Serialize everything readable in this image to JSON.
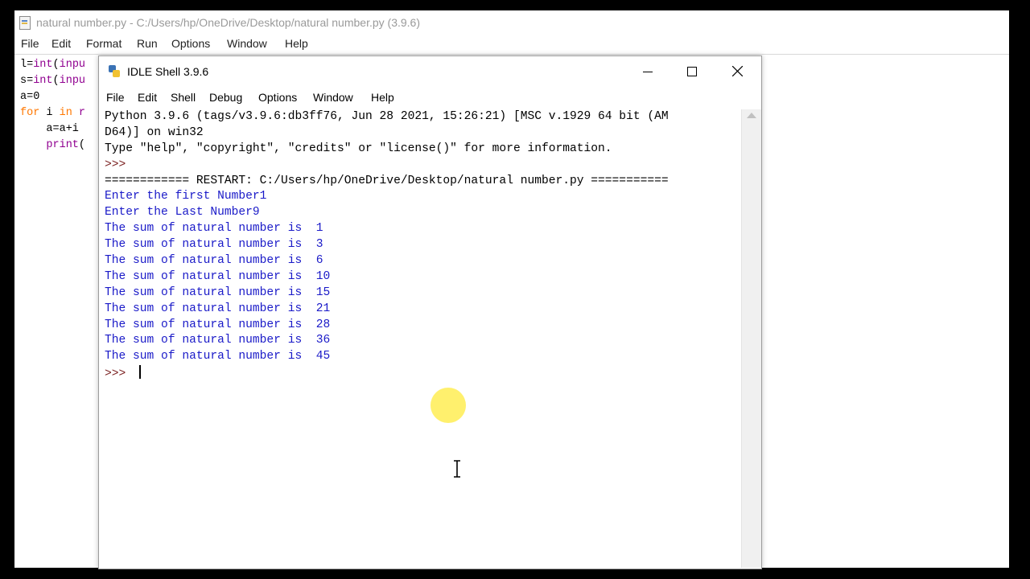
{
  "editor": {
    "title": "natural number.py - C:/Users/hp/OneDrive/Desktop/natural number.py (3.9.6)",
    "menu": [
      "File",
      "Edit",
      "Format",
      "Run",
      "Options",
      "Window",
      "Help"
    ],
    "code_lines": [
      {
        "segments": [
          {
            "t": "l=",
            "c": "tx"
          },
          {
            "t": "int",
            "c": "bi"
          },
          {
            "t": "(",
            "c": "tx"
          },
          {
            "t": "inpu",
            "c": "bi"
          }
        ]
      },
      {
        "segments": [
          {
            "t": "s=",
            "c": "tx"
          },
          {
            "t": "int",
            "c": "bi"
          },
          {
            "t": "(",
            "c": "tx"
          },
          {
            "t": "inpu",
            "c": "bi"
          }
        ]
      },
      {
        "segments": [
          {
            "t": "a=0",
            "c": "tx"
          }
        ]
      },
      {
        "segments": [
          {
            "t": "for",
            "c": "kw"
          },
          {
            "t": " i ",
            "c": "tx"
          },
          {
            "t": "in",
            "c": "kw"
          },
          {
            "t": " r",
            "c": "bi"
          }
        ]
      },
      {
        "segments": [
          {
            "t": "    a=a+i",
            "c": "tx"
          }
        ]
      },
      {
        "segments": [
          {
            "t": "    ",
            "c": "tx"
          },
          {
            "t": "print",
            "c": "bi"
          },
          {
            "t": "(",
            "c": "tx"
          }
        ]
      }
    ]
  },
  "shell": {
    "title": "IDLE Shell 3.9.6",
    "menu": [
      "File",
      "Edit",
      "Shell",
      "Debug",
      "Options",
      "Window",
      "Help"
    ],
    "lines": [
      {
        "text": "Python 3.9.6 (tags/v3.9.6:db3ff76, Jun 28 2021, 15:26:21) [MSC v.1929 64 bit (AM",
        "kind": "console"
      },
      {
        "text": "D64)] on win32",
        "kind": "console"
      },
      {
        "text": "Type \"help\", \"copyright\", \"credits\" or \"license()\" for more information.",
        "kind": "console"
      },
      {
        "text": ">>> ",
        "kind": "prompt"
      },
      {
        "text": "============ RESTART: C:/Users/hp/OneDrive/Desktop/natural number.py ===========",
        "kind": "console"
      },
      {
        "text": "Enter the first Number1",
        "kind": "output"
      },
      {
        "text": "Enter the Last Number9",
        "kind": "output"
      },
      {
        "text": "The sum of natural number is  1",
        "kind": "output"
      },
      {
        "text": "The sum of natural number is  3",
        "kind": "output"
      },
      {
        "text": "The sum of natural number is  6",
        "kind": "output"
      },
      {
        "text": "The sum of natural number is  10",
        "kind": "output"
      },
      {
        "text": "The sum of natural number is  15",
        "kind": "output"
      },
      {
        "text": "The sum of natural number is  21",
        "kind": "output"
      },
      {
        "text": "The sum of natural number is  28",
        "kind": "output"
      },
      {
        "text": "The sum of natural number is  36",
        "kind": "output"
      },
      {
        "text": "The sum of natural number is  45",
        "kind": "output"
      },
      {
        "text": ">>> ",
        "kind": "prompt",
        "caret": true
      }
    ],
    "window_buttons": {
      "minimize": "minimize-icon",
      "maximize": "maximize-icon",
      "close": "close-icon"
    }
  },
  "colors": {
    "console_text": "#000000",
    "stdout_text": "#1a1ac8",
    "prompt_text": "#7a1f1f",
    "keyword": "#ff7700",
    "builtin": "#900090",
    "cursor_highlight": "#ffeb3c"
  }
}
